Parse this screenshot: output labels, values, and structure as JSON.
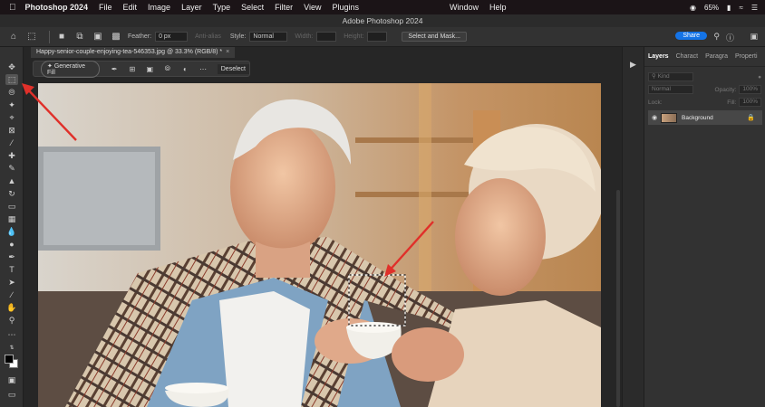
{
  "menubar": {
    "app": "Photoshop 2024",
    "items": [
      "File",
      "Edit",
      "Image",
      "Layer",
      "Type",
      "Select",
      "Filter",
      "View",
      "Plugins",
      "Window",
      "Help"
    ],
    "battery": "65%"
  },
  "titlebar": {
    "title": "Adobe Photoshop 2024"
  },
  "options": {
    "feather_label": "Feather:",
    "feather_value": "0 px",
    "antialias_label": "Anti-alias",
    "style_label": "Style:",
    "style_value": "Normal",
    "width_label": "Width:",
    "height_label": "Height:",
    "select_mask_label": "Select and Mask...",
    "share_label": "Share"
  },
  "document": {
    "tab_title": "Happy-senior-couple-enjoying-tea-546353.jpg @ 33.3% (RGB/8) *"
  },
  "taskbar": {
    "generative_fill": "Generative Fill",
    "deselect": "Deselect"
  },
  "panel": {
    "tabs": [
      "Layers",
      "Charact",
      "Paragra",
      "Properti"
    ],
    "kind_placeholder": "Kind",
    "blend_mode": "Normal",
    "opacity_label": "Opacity:",
    "opacity_value": "100%",
    "lock_label": "Lock:",
    "fill_label": "Fill:",
    "fill_value": "100%",
    "layer_name": "Background"
  },
  "colors": {
    "accent": "#1473e6",
    "annotation": "#e0302a"
  }
}
